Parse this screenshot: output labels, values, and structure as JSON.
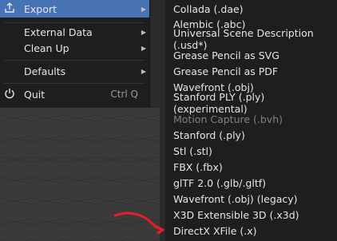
{
  "main_menu": {
    "export": {
      "label": "Export",
      "icon": "export-icon"
    },
    "external_data": {
      "label": "External Data"
    },
    "clean_up": {
      "label": "Clean Up"
    },
    "defaults": {
      "label": "Defaults"
    },
    "quit": {
      "label": "Quit",
      "shortcut": "Ctrl Q",
      "icon": "power-icon"
    }
  },
  "export_submenu": {
    "items": [
      {
        "label": "Collada (.dae)",
        "enabled": true
      },
      {
        "label": "Alembic (.abc)",
        "enabled": true
      },
      {
        "label": "Universal Scene Description (.usd*)",
        "enabled": true
      },
      {
        "label": "Grease Pencil as SVG",
        "enabled": true
      },
      {
        "label": "Grease Pencil as PDF",
        "enabled": true
      },
      {
        "label": "Wavefront (.obj)",
        "enabled": true
      },
      {
        "label": "Stanford PLY (.ply) (experimental)",
        "enabled": true
      },
      {
        "label": "Motion Capture (.bvh)",
        "enabled": false
      },
      {
        "label": "Stanford (.ply)",
        "enabled": true
      },
      {
        "label": "Stl (.stl)",
        "enabled": true
      },
      {
        "label": "FBX (.fbx)",
        "enabled": true
      },
      {
        "label": "glTF 2.0 (.glb/.gltf)",
        "enabled": true
      },
      {
        "label": "Wavefront (.obj) (legacy)",
        "enabled": true
      },
      {
        "label": "X3D Extensible 3D (.x3d)",
        "enabled": true
      },
      {
        "label": "DirectX XFile (.x)",
        "enabled": true
      }
    ]
  },
  "colors": {
    "accent": "#4772b3",
    "menu_bg": "#1e1e1e",
    "annotation": "#e0202a"
  }
}
